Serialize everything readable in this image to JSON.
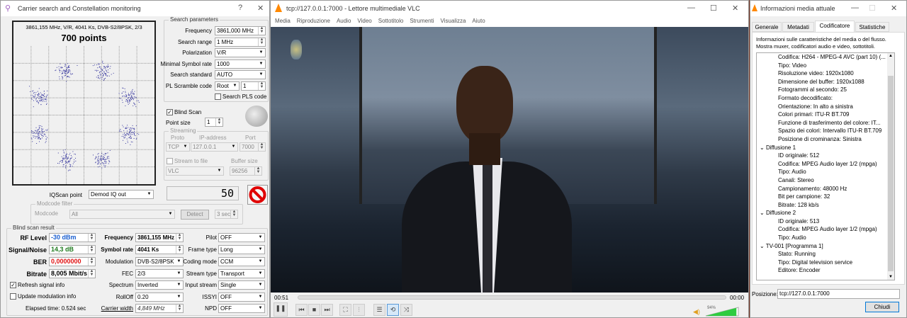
{
  "left": {
    "title": "Carrier search and Constellation monitoring",
    "help": "?",
    "close": "✕",
    "constellation": {
      "header": "3861,155 MHz, V/R, 4041 Ks, DVB-S2/8PSK, 2/3",
      "points_label": "700 points",
      "point_color": "#3a3aa0"
    },
    "search": {
      "title": "Search parameters",
      "frequency_label": "Frequency",
      "frequency": "3861,000 MHz",
      "range_label": "Search range",
      "range": "1 MHz",
      "pol_label": "Polarization",
      "pol": "V/R",
      "minsr_label": "Minimal Symbol rate",
      "minsr": "1000",
      "std_label": "Search standard",
      "std": "AUTO",
      "pls_label": "PL Scramble code",
      "pls_mode": "Root",
      "pls_value": "1",
      "search_pls_label": "Search PLS code"
    },
    "blind_scan_label": "Blind Scan",
    "point_size_label": "Point size",
    "point_size": "1",
    "streaming": {
      "title": "Streaming",
      "proto_label": "Proto",
      "ip_label": "IP-address",
      "port_label": "Port",
      "proto": "TCP",
      "ip": "127.0.0.1",
      "port": "7000",
      "stream_to_file_label": "Stream to file",
      "buffer_label": "Buffer size",
      "target": "VLC",
      "buffer": "96256"
    },
    "counter": "50",
    "iqscan_label": "IQScan point",
    "iqscan": "Demod IQ out",
    "modcode": {
      "title": "Modcode filter",
      "label": "Modcode",
      "value": "All",
      "detect": "Detect",
      "time": "3 sec"
    },
    "result": {
      "title": "Blind scan result",
      "rf_label": "RF Level",
      "rf": "-30 dBm",
      "rf_color": "#1a5fd0",
      "sn_label": "Signal/Noise",
      "sn": "14,3 dB",
      "sn_color": "#1e7a1e",
      "ber_label": "BER",
      "ber": "0,0000000",
      "ber_color": "#e01010",
      "bitrate_label": "Bitrate",
      "bitrate": "8,005 Mbit/s",
      "refresh_label": "Refresh signal info",
      "update_label": "Update modulation info",
      "elapsed": "Elapsed time: 0.524 sec",
      "freq_label": "Frequency",
      "freq": "3861,155 MHz",
      "sr_label": "Symbol rate",
      "sr": "4041 Ks",
      "mod_label": "Modulation",
      "mod": "DVB-S2/8PSK",
      "fec_label": "FEC",
      "fec": "2/3",
      "spectrum_label": "Spectrum",
      "spectrum": "Inverted",
      "rolloff_label": "RollOff",
      "rolloff": "0.20",
      "cw_label": "Carrier width",
      "cw": "4,849 MHz",
      "pilot_label": "Pilot",
      "pilot": "OFF",
      "frame_label": "Frame type",
      "frame": "Long",
      "coding_label": "Coding mode",
      "coding": "CCM",
      "stype_label": "Stream type",
      "stype": "Transport",
      "input_label": "Input stream",
      "input": "Single",
      "issyi_label": "ISSYI",
      "issyi": "OFF",
      "npd_label": "NPD",
      "npd": "OFF"
    }
  },
  "vlc": {
    "title": "tcp://127.0.0.1:7000 - Lettore multimediale VLC",
    "menu": [
      "Media",
      "Riproduzione",
      "Audio",
      "Video",
      "Sottotitolo",
      "Strumenti",
      "Visualizza",
      "Aiuto"
    ],
    "elapsed": "00:51",
    "remaining": "00:00",
    "volume": "94%",
    "volume_level": 0.94,
    "accent": "#ff8800"
  },
  "info": {
    "title": "Informazioni media attuale",
    "tabs": [
      "Generale",
      "Metadati",
      "Codificatore",
      "Statistiche"
    ],
    "active_tab": 2,
    "desc1": "Informazioni sulle caratteristiche del media o del flusso.",
    "desc2": "Mostra muxer, codificatori audio e video, sottotitoli.",
    "tree": [
      {
        "lvl": 2,
        "t": "Codifica: H264 - MPEG-4 AVC (part 10) (..."
      },
      {
        "lvl": 2,
        "t": "Tipo: Video"
      },
      {
        "lvl": 2,
        "t": "Risoluzione video: 1920x1080"
      },
      {
        "lvl": 2,
        "t": "Dimensione del buffer: 1920x1088"
      },
      {
        "lvl": 2,
        "t": "Fotogrammi al secondo: 25"
      },
      {
        "lvl": 2,
        "t": "Formato decodificato:"
      },
      {
        "lvl": 2,
        "t": "Orientazione: In alto a sinistra"
      },
      {
        "lvl": 2,
        "t": "Colori primari: ITU-R BT.709"
      },
      {
        "lvl": 2,
        "t": "Funzione di trasferimento del colore: IT..."
      },
      {
        "lvl": 2,
        "t": "Spazio dei colori: Intervallo ITU-R BT.709"
      },
      {
        "lvl": 2,
        "t": "Posizione di crominanza: Sinistra"
      },
      {
        "lvl": 1,
        "t": "Diffusione 1"
      },
      {
        "lvl": 2,
        "t": "ID originale: 512"
      },
      {
        "lvl": 2,
        "t": "Codifica: MPEG Audio layer 1/2 (mpga)"
      },
      {
        "lvl": 2,
        "t": "Tipo: Audio"
      },
      {
        "lvl": 2,
        "t": "Canali: Stereo"
      },
      {
        "lvl": 2,
        "t": "Campionamento: 48000 Hz"
      },
      {
        "lvl": 2,
        "t": "Bit per campione: 32"
      },
      {
        "lvl": 2,
        "t": "Bitrate: 128 kb/s"
      },
      {
        "lvl": 1,
        "t": "Diffusione 2"
      },
      {
        "lvl": 2,
        "t": "ID originale: 513"
      },
      {
        "lvl": 2,
        "t": "Codifica: MPEG Audio layer 1/2 (mpga)"
      },
      {
        "lvl": 2,
        "t": "Tipo: Audio"
      },
      {
        "lvl": 1,
        "t": "TV-001 [Programma 1]"
      },
      {
        "lvl": 2,
        "t": "Stato: Running"
      },
      {
        "lvl": 2,
        "t": "Tipo: Digital television service"
      },
      {
        "lvl": 2,
        "t": "Editore: Encoder"
      }
    ],
    "position_label": "Posizione:",
    "position": "tcp://127.0.0.1:7000",
    "close": "Chiudi"
  }
}
